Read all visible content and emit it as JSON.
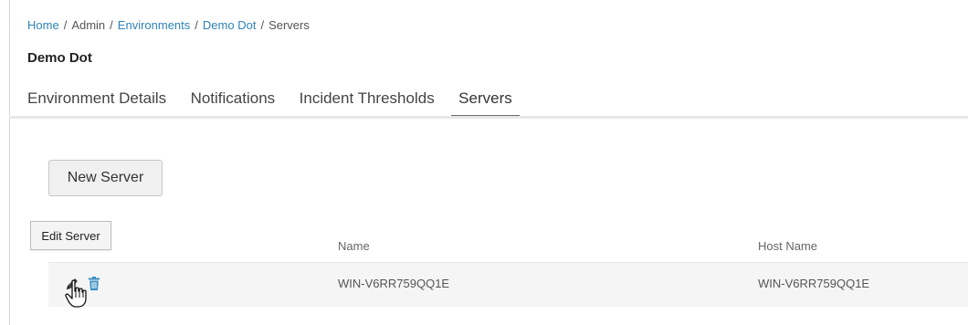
{
  "breadcrumb": {
    "home": "Home",
    "admin": "Admin",
    "environments": "Environments",
    "environment": "Demo Dot",
    "current": "Servers",
    "separator": "/"
  },
  "page": {
    "title": "Demo Dot"
  },
  "tabs": [
    {
      "label": "Environment Details",
      "active": false
    },
    {
      "label": "Notifications",
      "active": false
    },
    {
      "label": "Incident Thresholds",
      "active": false
    },
    {
      "label": "Servers",
      "active": true
    }
  ],
  "actions": {
    "new_server_label": "New Server"
  },
  "tooltip": {
    "text": "Edit Server"
  },
  "table": {
    "columns": [
      "Name",
      "Host Name"
    ],
    "rows": [
      {
        "name": "WIN-V6RR759QQ1E",
        "host_name": "WIN-V6RR759QQ1E"
      }
    ]
  },
  "icons": {
    "edit": "pencil-icon",
    "delete": "trash-icon",
    "cursor": "hand-pointer-cursor"
  },
  "colors": {
    "link": "#2f82b8",
    "delete_icon": "#3a8fc4",
    "row_background": "#f5f5f5",
    "active_tab_underline": "#6b6b6b"
  }
}
